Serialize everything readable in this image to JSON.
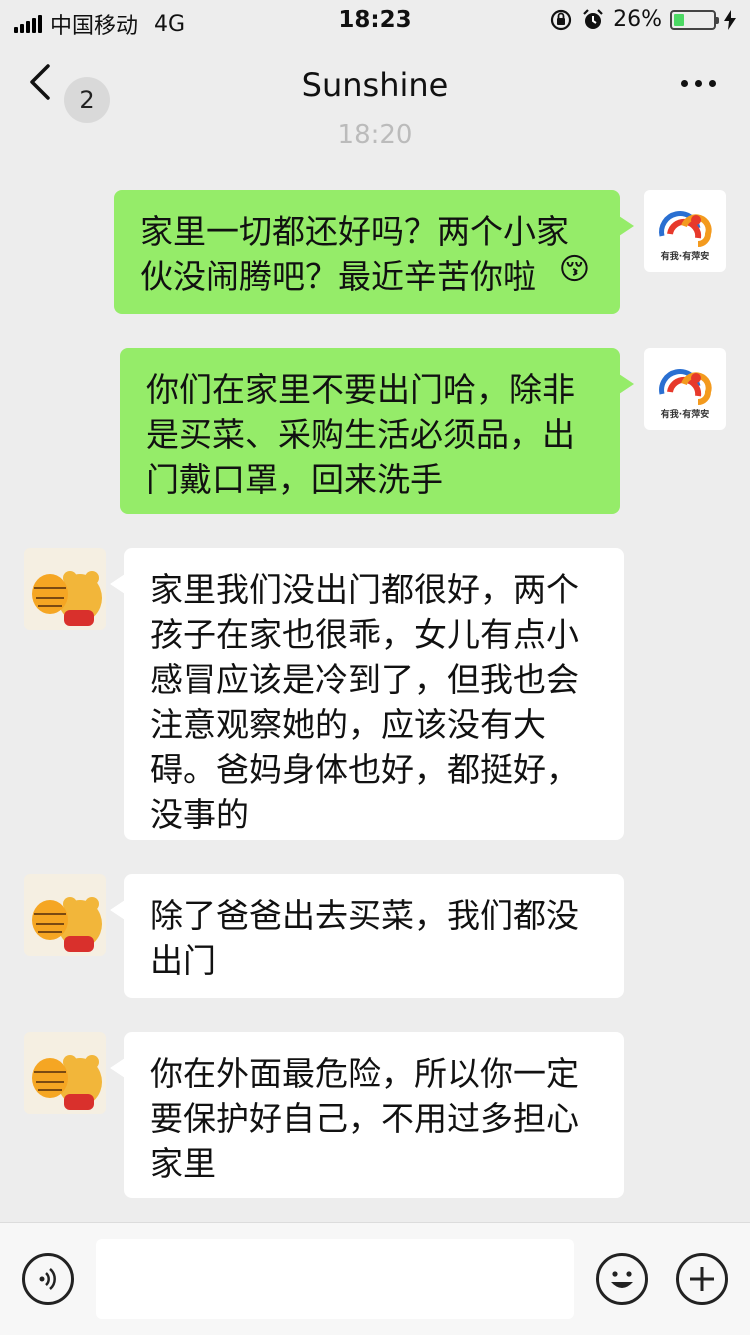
{
  "status_bar": {
    "carrier": "中国移动",
    "network": "4G",
    "time": "18:23",
    "battery_percent": "26%",
    "battery_level": 0.26,
    "icons": [
      "signal-icon",
      "rotation-lock-icon",
      "alarm-icon",
      "battery-icon",
      "charging-bolt-icon"
    ]
  },
  "nav": {
    "back_icon": "chevron-left-icon",
    "unread_count": "2",
    "title": "Sunshine",
    "more_icon": "more-dots-icon"
  },
  "chat": {
    "timestamp": "18:20",
    "messages": [
      {
        "sender": "me",
        "text": "家里一切都还好吗？两个小家\n伙没闹腾吧？最近辛苦你啦",
        "emoji": "😚",
        "avatar_caption": "有我·有萍安"
      },
      {
        "sender": "me",
        "text": "你们在家里不要出门哈，除非\n是买菜、采购生活必须品，出\n门戴口罩，回来洗手",
        "avatar_caption": "有我·有萍安"
      },
      {
        "sender": "other",
        "text": "家里我们没出门都很好，两个\n孩子在家也很乖，女儿有点小\n感冒应该是冷到了，但我也会\n注意观察她的，应该没有大\n碍。爸妈身体也好，都挺好，\n没事的"
      },
      {
        "sender": "other",
        "text": "除了爸爸出去买菜，我们都没\n出门"
      },
      {
        "sender": "other",
        "text": "你在外面最危险，所以你一定\n要保护好自己，不用过多担心\n家里"
      }
    ]
  },
  "input_bar": {
    "voice_icon": "voice-icon",
    "emoji_icon": "emoji-icon",
    "plus_icon": "plus-icon",
    "text_value": ""
  },
  "colors": {
    "background": "#ededed",
    "my_bubble": "#95ec69",
    "their_bubble": "#ffffff",
    "battery_fill": "#4cd964"
  }
}
